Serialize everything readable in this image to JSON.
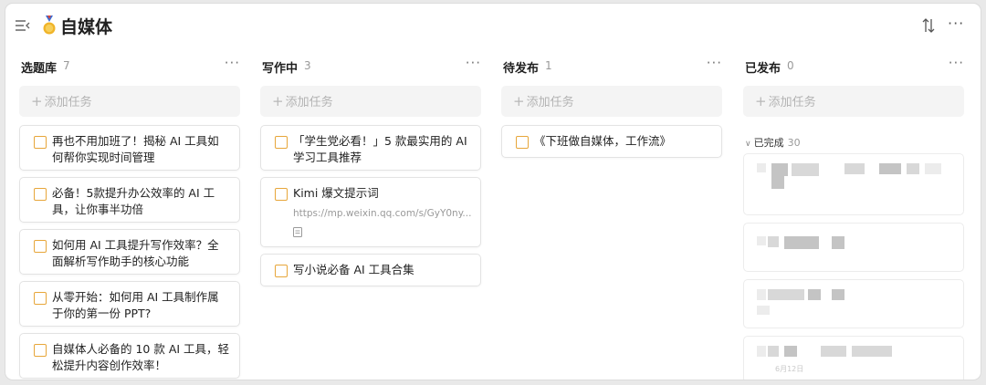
{
  "header": {
    "title": "自媒体",
    "menu_icon": "sidebar-menu-icon",
    "title_icon": "medal-icon",
    "sort_icon": "sort-icon",
    "more_label": "···"
  },
  "add_task_label": "添加任务",
  "columns": [
    {
      "title": "选题库",
      "count": "7",
      "more": "···",
      "cards": [
        {
          "text": "再也不用加班了！揭秘 AI 工具如何帮你实现时间管理"
        },
        {
          "text": "必备！5款提升办公效率的 AI 工具，让你事半功倍"
        },
        {
          "text": "如何用 AI 工具提升写作效率？全面解析写作助手的核心功能"
        },
        {
          "text": "从零开始：如何用 AI 工具制作属于你的第一份 PPT?"
        },
        {
          "text": "自媒体人必备的 10 款 AI 工具，轻松提升内容创作效率！"
        }
      ]
    },
    {
      "title": "写作中",
      "count": "3",
      "more": "···",
      "cards": [
        {
          "text": "「学生党必看！」5 款最实用的 AI 学习工具推荐"
        },
        {
          "text": "Kimi 爆文提示词",
          "url": "https://mp.weixin.qq.com/s/GyY0ny..."
        },
        {
          "text": "写小说必备 AI 工具合集"
        }
      ]
    },
    {
      "title": "待发布",
      "count": "1",
      "more": "···",
      "cards": [
        {
          "text": "《下班做自媒体，工作流》"
        }
      ]
    },
    {
      "title": "已发布",
      "count": "0",
      "more": "···",
      "completed": {
        "label": "已完成",
        "count": "30",
        "date_hint": "6月12日"
      }
    }
  ],
  "colors": {
    "checkbox_border": "#e7a63a",
    "page_bg": "#ffffff",
    "add_task_bg": "#f4f4f4"
  }
}
